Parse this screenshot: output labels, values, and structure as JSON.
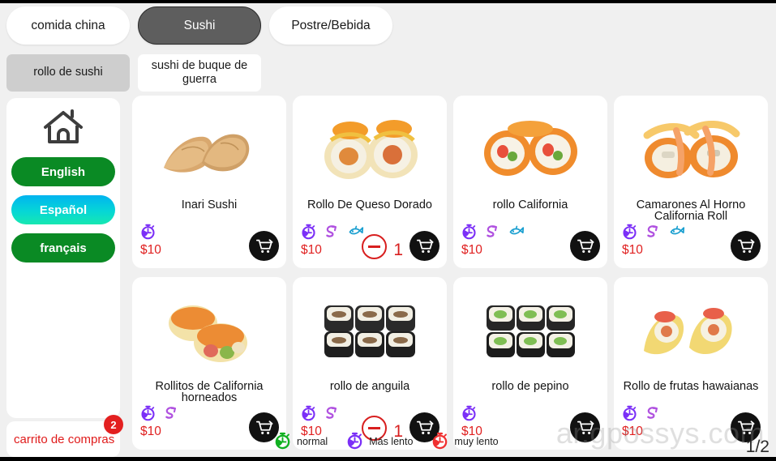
{
  "app": {
    "watermark": "ar.gpossys.com",
    "page_indicator": "1/2",
    "accent_red": "#e02020",
    "accent_green": "#0a8a24",
    "active_tab_bg": "#5e5e5e"
  },
  "categories": [
    {
      "label": "comida china",
      "active": false
    },
    {
      "label": "Sushi",
      "active": true
    },
    {
      "label": "Postre/Bebida",
      "active": false
    }
  ],
  "subcategories": [
    {
      "label": "rollo de sushi",
      "active": true
    },
    {
      "label": "sushi de buque de guerra",
      "active": false
    }
  ],
  "sidebar": {
    "home_icon": "home-icon",
    "languages": [
      {
        "label": "English",
        "active": false
      },
      {
        "label": "Español",
        "active": true
      },
      {
        "label": "français",
        "active": false
      }
    ],
    "cart": {
      "label": "carrito de compras",
      "badge": "2"
    }
  },
  "legend": [
    {
      "icon": "timer-icon-green",
      "label": "normal",
      "color": "#10b020"
    },
    {
      "icon": "timer-icon-purple",
      "label": "Más lento",
      "color": "#7b2ff7"
    },
    {
      "icon": "timer-icon-red",
      "label": "muy lento",
      "color": "#f03030"
    }
  ],
  "products": [
    {
      "name": "Inari Sushi",
      "price": "$10",
      "icons": [
        "timer-icon"
      ],
      "qty": null,
      "art": "inari"
    },
    {
      "name": "Rollo De Queso Dorado",
      "price": "$10",
      "icons": [
        "timer-icon",
        "swirl-icon",
        "fish-icon"
      ],
      "qty": "1",
      "art": "cheese-roll"
    },
    {
      "name": "rollo California",
      "price": "$10",
      "icons": [
        "timer-icon",
        "swirl-icon",
        "fish-icon"
      ],
      "qty": null,
      "art": "california"
    },
    {
      "name": "Camarones Al Horno California Roll",
      "price": "$10",
      "icons": [
        "timer-icon",
        "swirl-icon",
        "fish-icon"
      ],
      "qty": null,
      "art": "shrimp-baked"
    },
    {
      "name": "Rollitos de California horneados",
      "price": "$10",
      "icons": [
        "timer-icon",
        "swirl-icon"
      ],
      "qty": null,
      "art": "baked-roll"
    },
    {
      "name": "rollo de anguila",
      "price": "$10",
      "icons": [
        "timer-icon",
        "swirl-icon"
      ],
      "qty": "1",
      "art": "eel"
    },
    {
      "name": "rollo de pepino",
      "price": "$10",
      "icons": [
        "timer-icon"
      ],
      "qty": null,
      "art": "cucumber"
    },
    {
      "name": "Rollo de frutas hawaianas",
      "price": "$10",
      "icons": [
        "timer-icon",
        "swirl-icon"
      ],
      "qty": null,
      "art": "hawaiian"
    }
  ]
}
